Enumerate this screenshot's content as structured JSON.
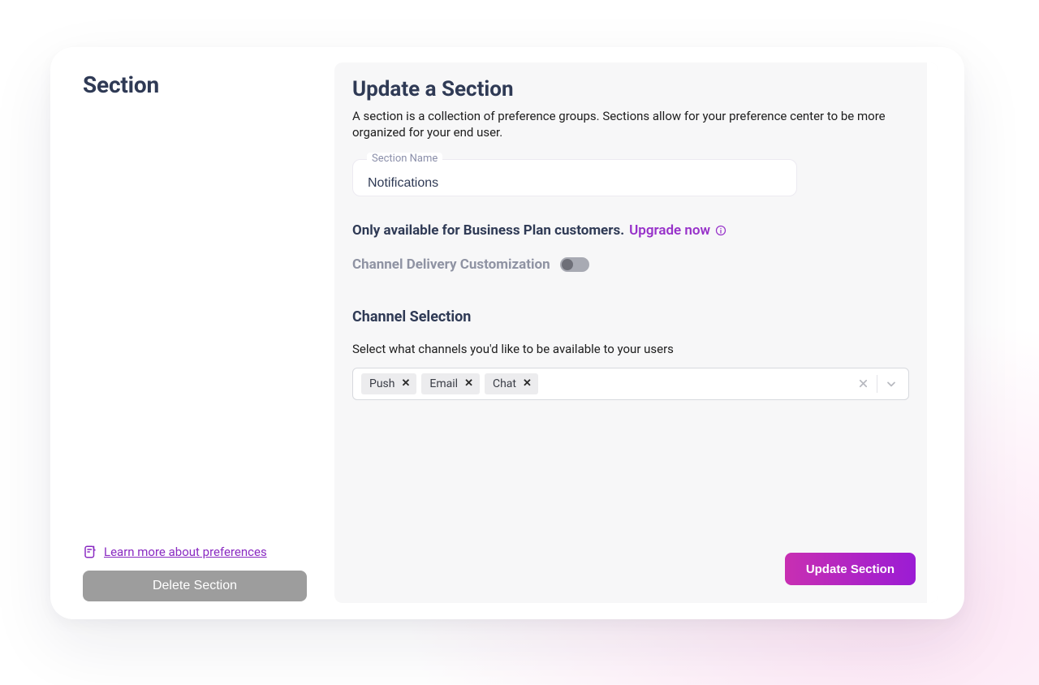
{
  "left": {
    "title": "Section",
    "learn_more": "Learn more about preferences",
    "delete_label": "Delete Section"
  },
  "panel": {
    "title": "Update a Section",
    "description": "A section is a collection of preference groups. Sections allow for your preference center to be more organized for your end user.",
    "section_name_label": "Section Name",
    "section_name_value": "Notifications",
    "plan_text": "Only available for Business Plan customers.",
    "upgrade_text": "Upgrade now",
    "channel_custom_label": "Channel Delivery Customization",
    "channel_custom_on": false,
    "channel_selection_title": "Channel Selection",
    "channel_selection_desc": "Select what channels you'd like to be available to your users",
    "channels": [
      "Push",
      "Email",
      "Chat"
    ],
    "update_label": "Update Section"
  },
  "colors": {
    "accent": "#9731c9",
    "heading": "#2f3a55",
    "gradient_from": "#c82fb2",
    "gradient_to": "#9b1cd4"
  }
}
